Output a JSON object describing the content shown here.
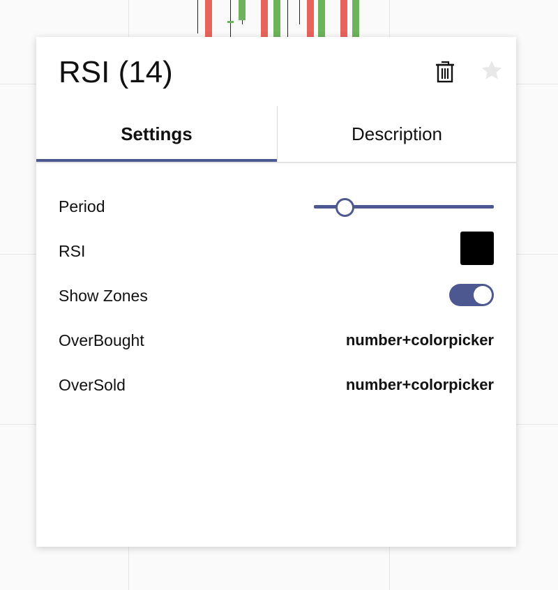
{
  "colors": {
    "accent": "#4d5891",
    "candle_up": "#6cb35b",
    "candle_down": "#e8635a",
    "rsi_line": "#000000",
    "star_inactive": "#e8e8e8"
  },
  "dialog": {
    "title": "RSI (14)",
    "delete_icon": "trash-icon",
    "favorite_icon": "star-icon"
  },
  "tabs": [
    {
      "label": "Settings",
      "active": true
    },
    {
      "label": "Description",
      "active": false
    }
  ],
  "settings": {
    "period": {
      "label": "Period",
      "slider_fraction": 0.17
    },
    "rsi": {
      "label": "RSI",
      "color": "#000000"
    },
    "show_zones": {
      "label": "Show Zones",
      "enabled": true
    },
    "overbought": {
      "label": "OverBought",
      "value": "number+colorpicker"
    },
    "oversold": {
      "label": "OverSold",
      "value": "number+colorpicker"
    }
  }
}
